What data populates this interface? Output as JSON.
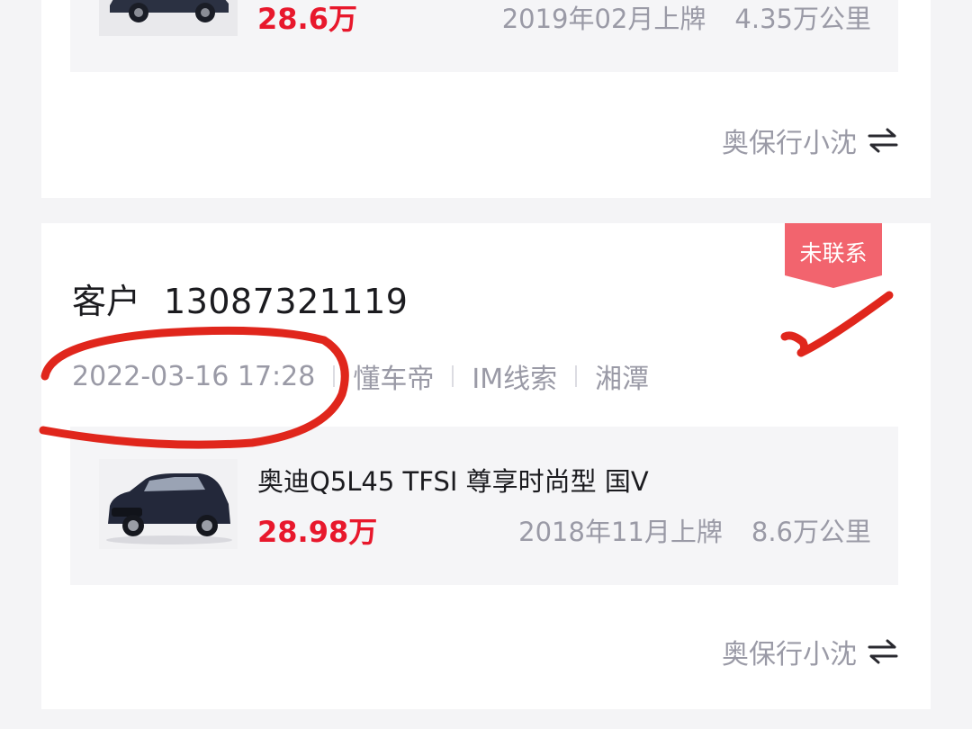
{
  "cards": [
    {
      "car": {
        "name": "",
        "price": "28.6万",
        "registration": "2019年02月上牌",
        "mileage": "4.35万公里"
      },
      "owner": {
        "name": "奥保行小沈",
        "icon": "swap-arrows-icon"
      }
    },
    {
      "status_badge": "未联系",
      "customer": {
        "label": "客户",
        "phone": "13087321119"
      },
      "meta": {
        "datetime": "2022-03-16 17:28",
        "source": "懂车帝",
        "lead_type": "IM线索",
        "city": "湘潭"
      },
      "car": {
        "name": "奥迪Q5L45 TFSI 尊享时尚型 国V",
        "price": "28.98万",
        "registration": "2018年11月上牌",
        "mileage": "8.6万公里"
      },
      "owner": {
        "name": "奥保行小沈",
        "icon": "swap-arrows-icon"
      }
    }
  ],
  "colors": {
    "price": "#e8182c",
    "badge": "#f2646e",
    "annotation": "#e0261c",
    "muted_text": "#9a9aa6",
    "background": "#f4f4f6"
  }
}
